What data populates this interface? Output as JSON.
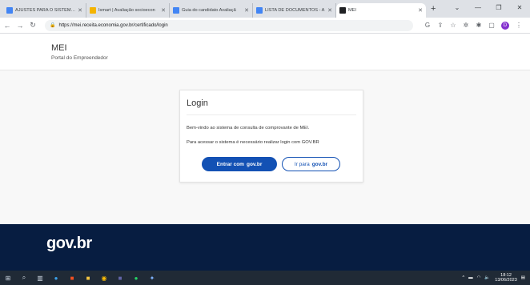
{
  "browser": {
    "tabs": [
      {
        "title": "AJUSTES PARA O SISTEMA D",
        "color": "#4285f4"
      },
      {
        "title": "Ismart | Avaliação socioecon",
        "color": "#f4b400"
      },
      {
        "title": "Guia do candidato Avaliaçã",
        "color": "#4285f4"
      },
      {
        "title": "LISTA DE DOCUMENTOS - A",
        "color": "#4285f4"
      },
      {
        "title": "MEI",
        "color": "#202124"
      }
    ],
    "new_tab_label": "+",
    "url": "https://mei.receita.economia.gov.br/certificado/login",
    "profile_initial": "D"
  },
  "header": {
    "title": "MEI",
    "subtitle": "Portal do Empreendedor"
  },
  "login": {
    "title": "Login",
    "welcome": "Bem-vindo ao sistema de consulta de comprovante de MEI.",
    "instruction": "Para acessar o sistema é necessário realizar login com GOV.BR",
    "primary_prefix": "Entrar com",
    "primary_brand": "gov.br",
    "secondary_prefix": "Ir para",
    "secondary_brand": "gov.br"
  },
  "footer": {
    "logo": "gov.br"
  },
  "taskbar": {
    "time": "18:12",
    "date": "13/06/2023"
  },
  "colors": {
    "brand_blue": "#1351b4",
    "footer_navy": "#071d41"
  }
}
